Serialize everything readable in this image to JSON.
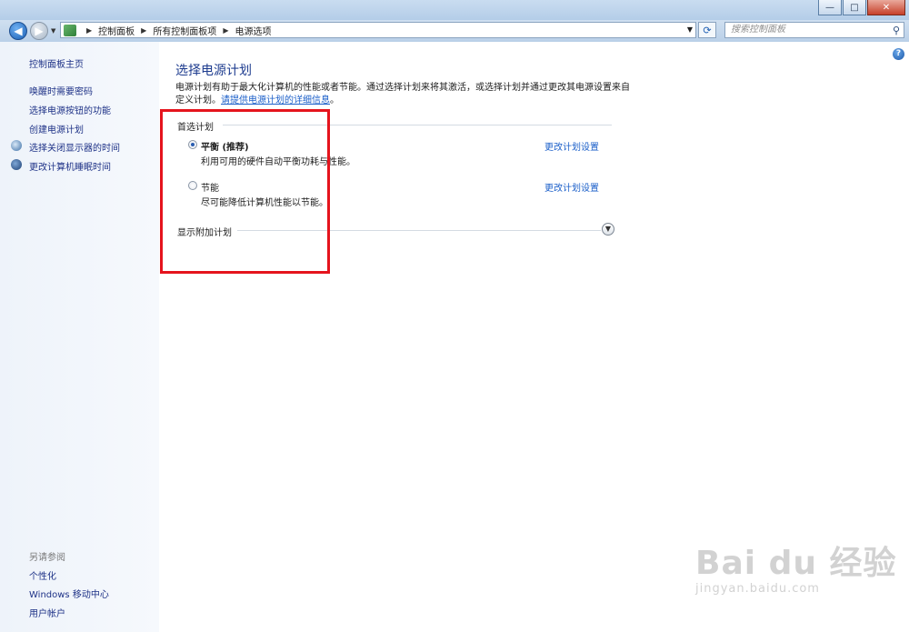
{
  "window": {
    "minimize_label": "—",
    "maximize_label": "□",
    "close_label": "✕"
  },
  "nav": {
    "back_icon": "◀",
    "forward_icon": "▶",
    "breadcrumb": [
      "控制面板",
      "所有控制面板项",
      "电源选项"
    ],
    "refresh_icon": "⟳",
    "search_placeholder": "搜索控制面板"
  },
  "sidebar": {
    "home": "控制面板主页",
    "items": [
      {
        "label": "唤醒时需要密码"
      },
      {
        "label": "选择电源按钮的功能"
      },
      {
        "label": "创建电源计划"
      },
      {
        "label": "选择关闭显示器的时间",
        "icon": "monitor-icon"
      },
      {
        "label": "更改计算机睡眠时间",
        "icon": "moon-icon"
      }
    ],
    "see_also_title": "另请参阅",
    "see_also": [
      "个性化",
      "Windows 移动中心",
      "用户帐户"
    ]
  },
  "main": {
    "title": "选择电源计划",
    "intro_text": "电源计划有助于最大化计算机的性能或者节能。通过选择计划来将其激活，或选择计划并通过更改其电源设置来自定义计划。",
    "intro_link": "请提供电源计划的详细信息",
    "intro_end": "。",
    "preferred_heading": "首选计划",
    "plans": [
      {
        "name": "平衡 (推荐)",
        "desc": "利用可用的硬件自动平衡功耗与性能。",
        "selected": true,
        "change_link": "更改计划设置"
      },
      {
        "name": "节能",
        "desc": "尽可能降低计算机性能以节能。",
        "selected": false,
        "change_link": "更改计划设置"
      }
    ],
    "more_plans": "显示附加计划",
    "help": "?"
  },
  "watermark": {
    "main": "Bai du 经验",
    "sub": "jingyan.baidu.com"
  },
  "colors": {
    "link": "#1b5fc9",
    "title": "#1e3c8f",
    "highlight_box": "#e5141d"
  }
}
